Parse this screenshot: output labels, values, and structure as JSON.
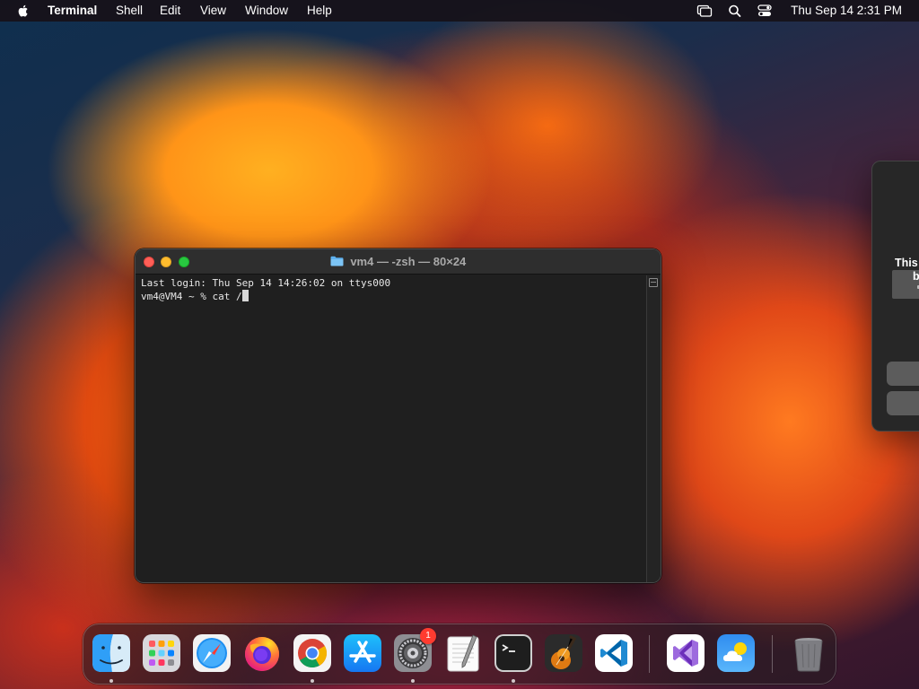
{
  "menubar": {
    "app_name": "Terminal",
    "menus": [
      "Shell",
      "Edit",
      "View",
      "Window",
      "Help"
    ],
    "status_icons": [
      "screen-mirroring-icon",
      "search-icon",
      "control-center-icon"
    ],
    "clock": "Thu Sep 14  2:31 PM"
  },
  "terminal": {
    "title": "vm4 — -zsh — 80×24",
    "lines": [
      "Last login: Thu Sep 14 14:26:02 on ttys000",
      "vm4@VM4 ~ % cat /"
    ]
  },
  "dialog": {
    "text_line_1": "This",
    "text_line_2": "b"
  },
  "dock": {
    "apps": [
      {
        "name": "Finder",
        "icon": "finder-icon",
        "running": true
      },
      {
        "name": "Launchpad",
        "icon": "launchpad-icon",
        "running": false
      },
      {
        "name": "Safari",
        "icon": "safari-icon",
        "running": false
      },
      {
        "name": "Firefox",
        "icon": "firefox-icon",
        "running": false
      },
      {
        "name": "Google Chrome",
        "icon": "chrome-icon",
        "running": true
      },
      {
        "name": "App Store",
        "icon": "app-store-icon",
        "running": false
      },
      {
        "name": "System Settings",
        "icon": "system-settings-icon",
        "running": true,
        "badge": "1"
      },
      {
        "name": "TextEdit",
        "icon": "textedit-icon",
        "running": false
      },
      {
        "name": "Terminal",
        "icon": "terminal-icon",
        "running": true
      },
      {
        "name": "GarageBand",
        "icon": "garageband-icon",
        "running": false
      },
      {
        "name": "Visual Studio Code",
        "icon": "vscode-icon",
        "running": false
      },
      {
        "name": "Visual Studio",
        "icon": "visual-studio-icon",
        "running": false
      },
      {
        "name": "Weather",
        "icon": "weather-icon",
        "running": false
      },
      {
        "name": "Trash",
        "icon": "trash-icon",
        "running": false
      }
    ]
  },
  "colors": {
    "close": "#ff5f57",
    "minimize": "#febc2e",
    "zoom": "#28c840",
    "badge": "#ff3b30"
  }
}
